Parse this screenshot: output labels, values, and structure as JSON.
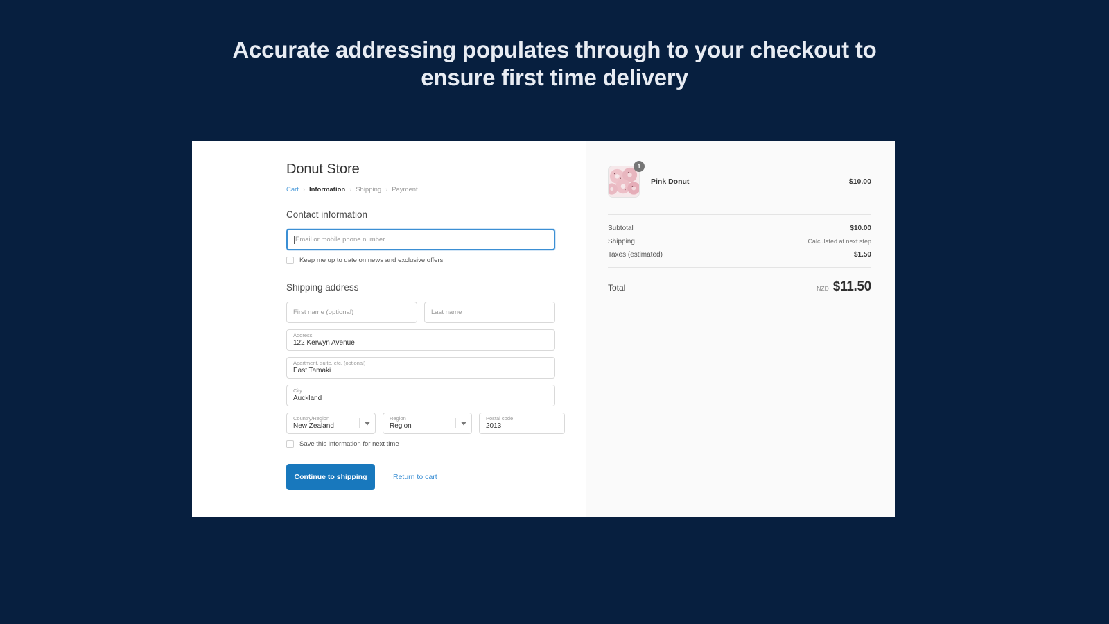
{
  "headline": "Accurate addressing populates through to your checkout to ensure first time delivery",
  "colors": {
    "background": "#071f3f",
    "accent_blue": "#1878bd",
    "link_blue": "#3b8fd4",
    "panel_bg": "#fafafa"
  },
  "checkout": {
    "store_name": "Donut Store",
    "breadcrumb": [
      {
        "label": "Cart",
        "state": "link"
      },
      {
        "label": "Information",
        "state": "current"
      },
      {
        "label": "Shipping",
        "state": "upcoming"
      },
      {
        "label": "Payment",
        "state": "upcoming"
      }
    ],
    "breadcrumb_separator": "›",
    "contact": {
      "section_title": "Contact information",
      "email_placeholder": "Email or mobile phone number",
      "email_value": "",
      "newsletter_label": "Keep me up to date on news and exclusive offers",
      "newsletter_checked": false
    },
    "shipping": {
      "section_title": "Shipping address",
      "first_name_placeholder": "First name (optional)",
      "first_name_value": "",
      "last_name_placeholder": "Last name",
      "last_name_value": "",
      "address_label": "Address",
      "address_value": "122 Kerwyn Avenue",
      "apartment_label": "Apartment, suite, etc. (optional)",
      "apartment_value": "East Tamaki",
      "city_label": "City",
      "city_value": "Auckland",
      "country_label": "Country/Region",
      "country_value": "New Zealand",
      "region_label": "Region",
      "region_value": "Region",
      "postal_label": "Postal code",
      "postal_value": "2013",
      "save_info_label": "Save this information for next time",
      "save_info_checked": false
    },
    "actions": {
      "continue_label": "Continue to shipping",
      "return_label": "Return to cart"
    }
  },
  "summary": {
    "product": {
      "name": "Pink Donut",
      "price": "$10.00",
      "quantity": "1",
      "image_alt": "pink-donuts-photo"
    },
    "lines": [
      {
        "label": "Subtotal",
        "value": "$10.00",
        "muted": false
      },
      {
        "label": "Shipping",
        "value": "Calculated at next step",
        "muted": true
      },
      {
        "label": "Taxes (estimated)",
        "value": "$1.50",
        "muted": false
      }
    ],
    "total": {
      "label": "Total",
      "currency": "NZD",
      "value": "$11.50"
    }
  }
}
